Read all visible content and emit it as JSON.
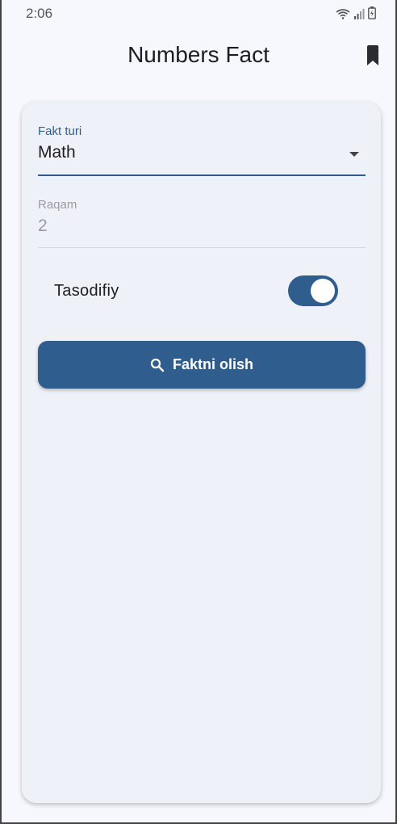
{
  "status_bar": {
    "time": "2:06"
  },
  "app_bar": {
    "title": "Numbers Fact",
    "bookmark_icon": "bookmark-icon"
  },
  "form": {
    "fact_type": {
      "label": "Fakt turi",
      "value": "Math"
    },
    "number": {
      "label": "Raqam",
      "value": "2"
    },
    "random": {
      "label": "Tasodifiy",
      "enabled": true
    },
    "submit_button": {
      "label": "Faktni olish",
      "icon": "search-icon"
    }
  },
  "colors": {
    "primary": "#2f5d8e",
    "background": "#f7f8fd",
    "card": "#eff1f9"
  }
}
